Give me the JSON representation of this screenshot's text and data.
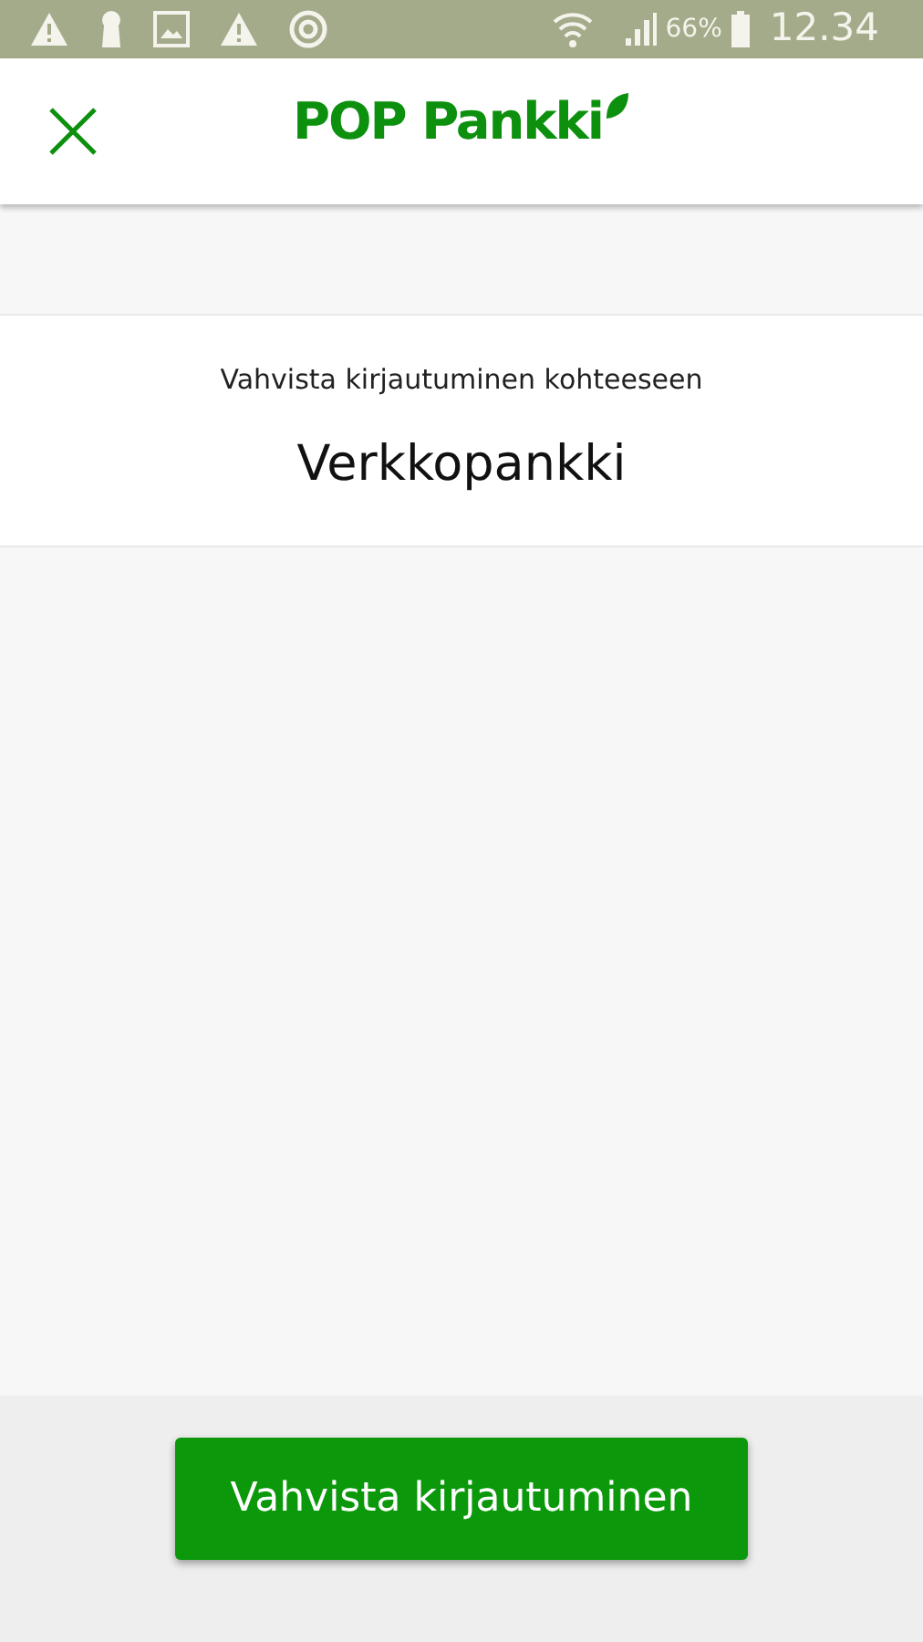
{
  "status_bar": {
    "battery": "66%",
    "time": "12.34"
  },
  "header": {
    "logo": "POP Pankki"
  },
  "confirm": {
    "prompt": "Vahvista kirjautuminen kohteeseen",
    "target": "Verkkopankki"
  },
  "button": "Vahvista kirjautuminen"
}
